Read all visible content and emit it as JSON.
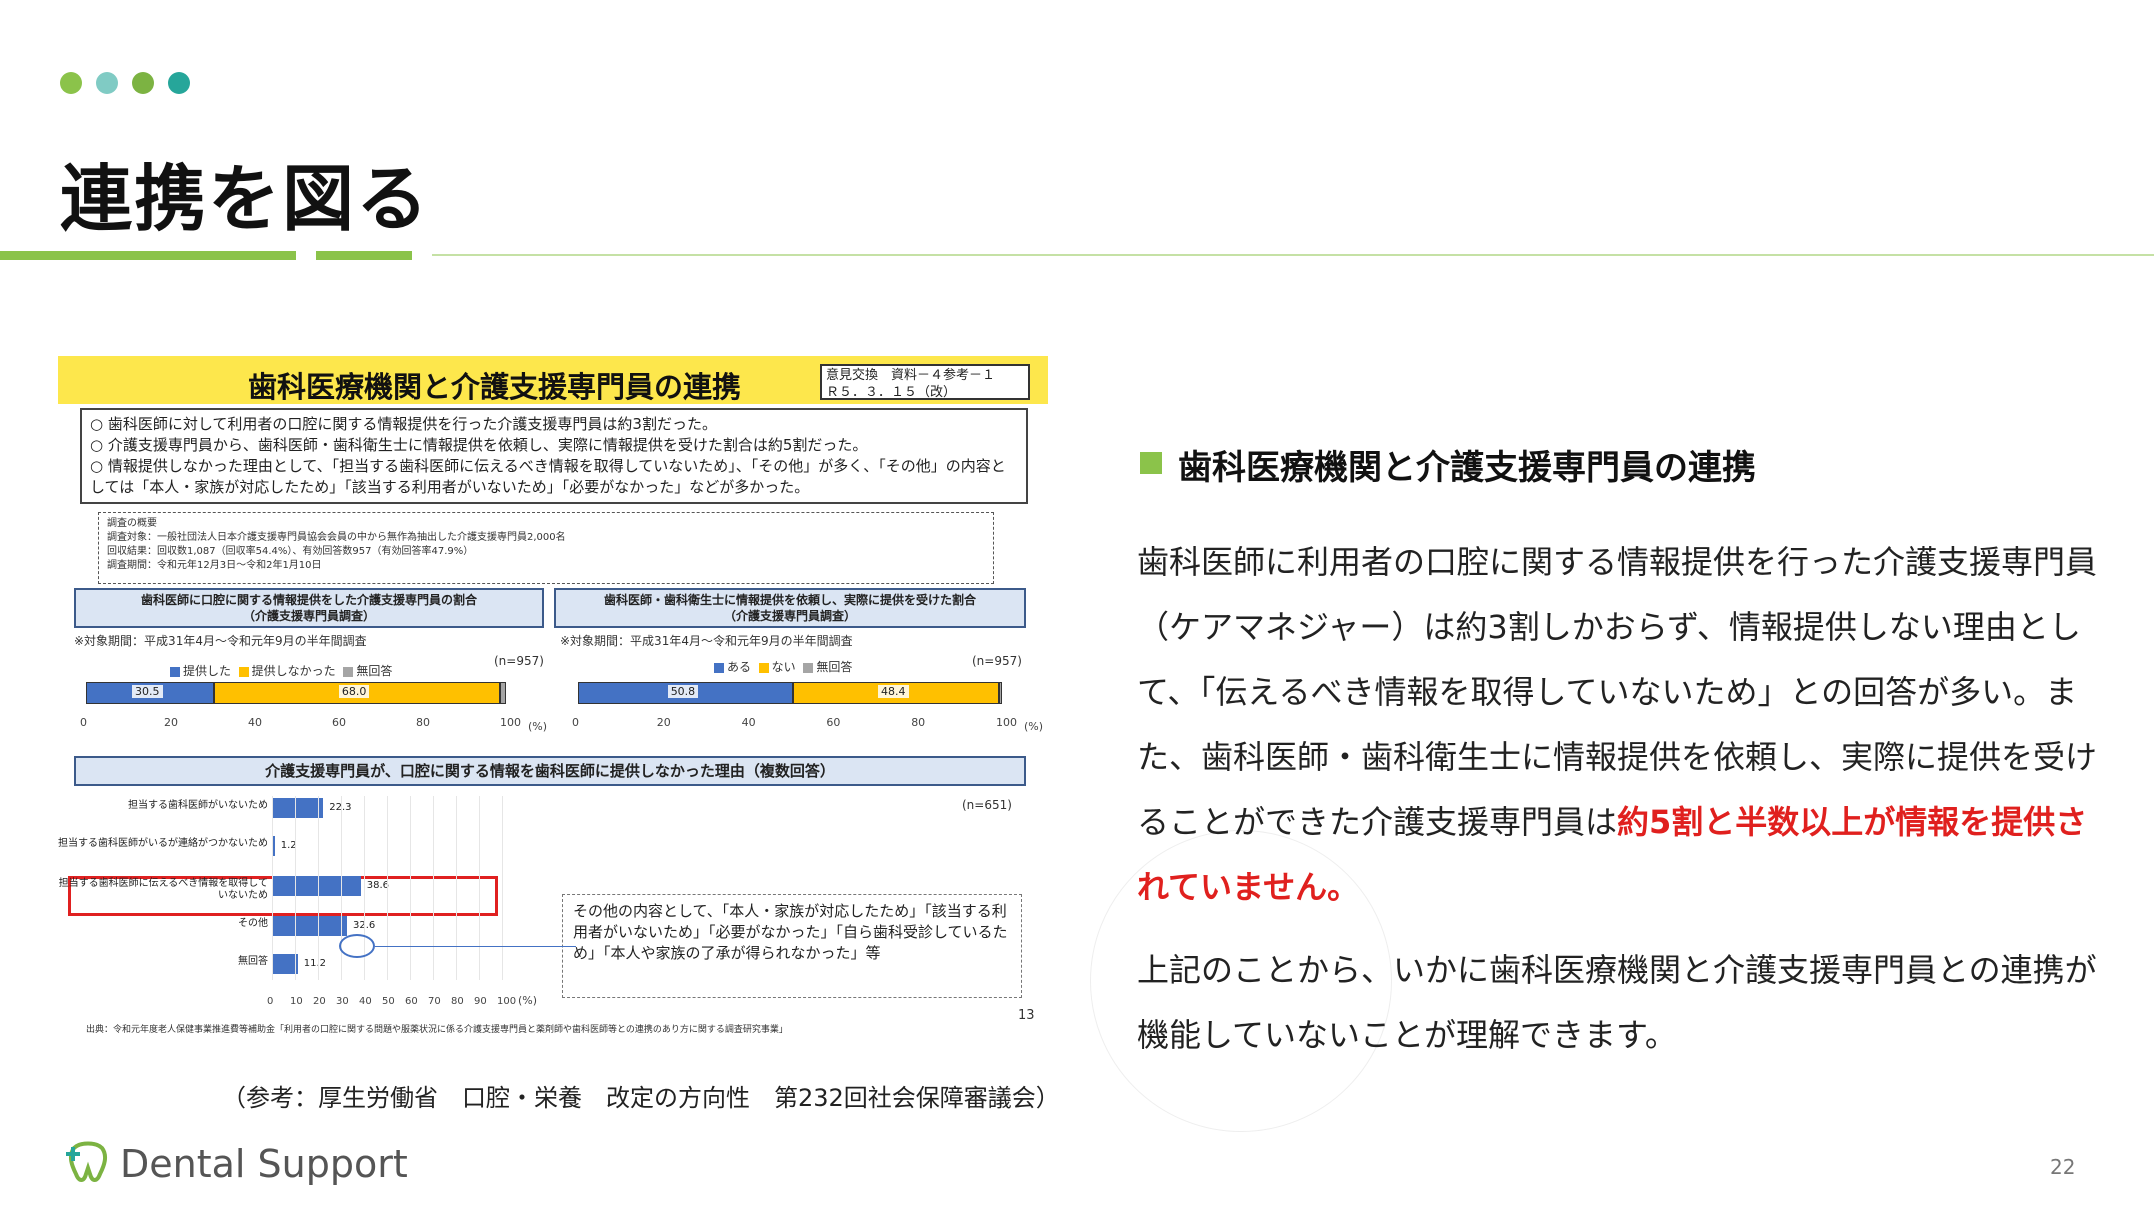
{
  "slide": {
    "title": "連携を図る",
    "dot_colors": [
      "#8bc34a",
      "#80cbc4",
      "#7cb342",
      "#26a69a"
    ],
    "accent_color": "#8bc34a",
    "page_number": "22"
  },
  "figure": {
    "title": "歯科医療機関と介護支援専門員の連携",
    "ref_line1": "意見交換　資料－４参考－１",
    "ref_line2": "Ｒ５．３．１５（改）",
    "points": [
      "歯科医師に対して利用者の口腔に関する情報提供を行った介護支援専門員は約3割だった。",
      "介護支援専門員から、歯科医師・歯科衛生士に情報提供を依頼し、実際に情報提供を受けた割合は約5割だった。",
      "情報提供しなかった理由として、「担当する歯科医師に伝えるべき情報を取得していないため」、「その他」が多く、「その他」の内容としては「本人・家族が対応したため」「該当する利用者がいないため」「必要がなかった」などが多かった。"
    ],
    "survey": {
      "heading": "調査の概要",
      "target": "調査対象：一般社団法人日本介護支援専門員協会会員の中から無作為抽出した介護支援専門員2,000名",
      "result": "回収結果：回収数1,087（回収率54.4%）、有効回答数957（有効回答率47.9%）",
      "period": "調査期間：令和元年12月3日～令和2年1月10日"
    },
    "left_chart": {
      "heading_line1": "歯科医師に口腔に関する情報提供をした介護支援専門員の割合",
      "heading_line2": "（介護支援専門員調査）",
      "period_note": "※対象期間：平成31年4月～令和元年9月の半年間調査",
      "n_label": "(n=957)",
      "legend": [
        "提供した",
        "提供しなかった",
        "無回答"
      ]
    },
    "right_chart": {
      "heading_line1": "歯科医師・歯科衛生士に情報提供を依頼し、実際に提供を受けた割合",
      "heading_line2": "（介護支援専門員調査）",
      "period_note": "※対象期間：平成31年4月～令和元年9月の半年間調査",
      "n_label": "(n=957)",
      "legend": [
        "ある",
        "ない",
        "無回答"
      ]
    },
    "bottom_chart": {
      "heading": "介護支援専門員が、口腔に関する情報を歯科医師に提供しなかった理由（複数回答）",
      "n_label": "(n=651)"
    },
    "callout": "その他の内容として、「本人・家族が対応したため」「該当する利用者がいないため」「必要がなかった」「自ら歯科受診しているため」「本人や家族の了承が得られなかった」等",
    "source": "出典：令和元年度老人保健事業推進費等補助金「利用者の口腔に関する問題や服薬状況に係る介護支援専門員と薬剤師や歯科医師等との連携のあり方に関する調査研究事業」",
    "page": "13",
    "percent_unit": "(%)"
  },
  "chart_data": [
    {
      "type": "bar",
      "stacked": true,
      "orientation": "horizontal",
      "categories": [
        "全体"
      ],
      "series": [
        {
          "name": "提供した",
          "values": [
            30.5
          ],
          "color": "#4472c4"
        },
        {
          "name": "提供しなかった",
          "values": [
            68.0
          ],
          "color": "#ffc000"
        },
        {
          "name": "無回答",
          "values": [
            1.5
          ],
          "color": "#a5a5a5"
        }
      ],
      "xlim": [
        0,
        100
      ],
      "xticks": [
        "0",
        "20",
        "40",
        "60",
        "80",
        "100"
      ],
      "labels": [
        "30.5",
        "68.0"
      ]
    },
    {
      "type": "bar",
      "stacked": true,
      "orientation": "horizontal",
      "categories": [
        "全体"
      ],
      "series": [
        {
          "name": "ある",
          "values": [
            50.8
          ],
          "color": "#4472c4"
        },
        {
          "name": "ない",
          "values": [
            48.4
          ],
          "color": "#ffc000"
        },
        {
          "name": "無回答",
          "values": [
            0.8
          ],
          "color": "#a5a5a5"
        }
      ],
      "xlim": [
        0,
        100
      ],
      "xticks": [
        "0",
        "20",
        "40",
        "60",
        "80",
        "100"
      ],
      "labels": [
        "50.8",
        "48.4"
      ]
    },
    {
      "type": "bar",
      "orientation": "horizontal",
      "categories": [
        "担当する歯科医師がいないため",
        "担当する歯科医師がいるが連絡がつかないため",
        "担当する歯科医師に伝えるべき情報を取得していないため",
        "その他",
        "無回答"
      ],
      "values": [
        22.3,
        1.2,
        38.6,
        32.6,
        11.2
      ],
      "labels": [
        "22.3",
        "1.2",
        "38.6",
        "32.6",
        "11.2"
      ],
      "xlim": [
        0,
        100
      ],
      "xticks": [
        "0",
        "10",
        "20",
        "30",
        "40",
        "50",
        "60",
        "70",
        "80",
        "90",
        "100"
      ]
    }
  ],
  "reference": "（参考：厚生労働省　口腔・栄養　改定の方向性　第232回社会保障審議会）",
  "section": {
    "title": "歯科医療機関と介護支援専門員の連携",
    "p1_normal": "歯科医師に利用者の口腔に関する情報提供を行った介護支援専門員（ケアマネジャー）は約3割しかおらず、情報提供しない理由として、「伝えるべき情報を取得していないため」との回答が多い。また、歯科医師・歯科衛生士に情報提供を依頼し、実際に提供を受けることができた介護支援専門員は",
    "p1_red": "約5割と半数以上が情報を提供されていません。",
    "p2": "上記のことから、いかに歯科医療機関と介護支援専門員との連携が機能していないことが理解できます。"
  },
  "logo": {
    "text": "Dental Support",
    "icon": "tooth-plus-icon"
  }
}
